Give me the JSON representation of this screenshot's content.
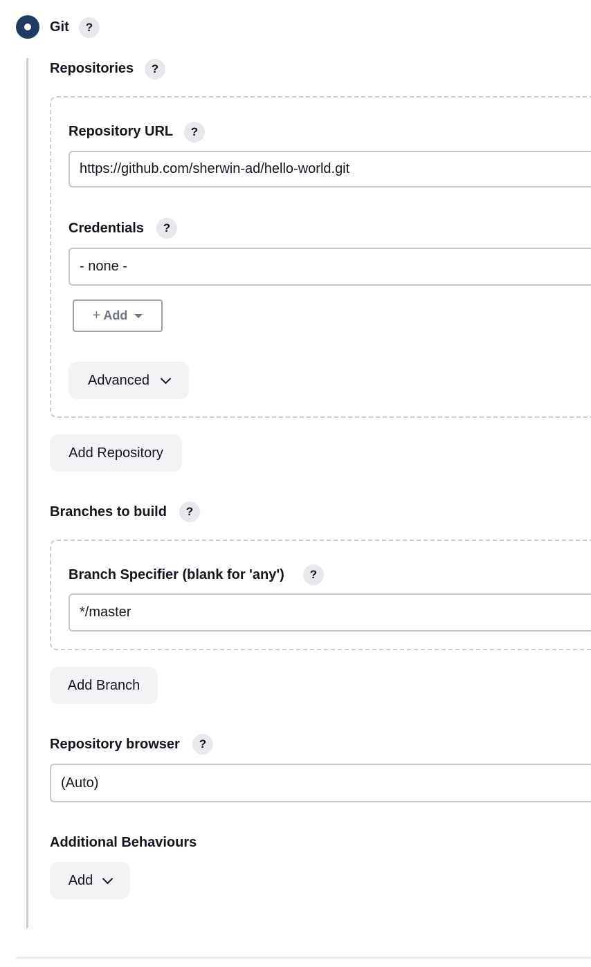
{
  "scm": {
    "option_label": "Git",
    "help": "?"
  },
  "repositories": {
    "label": "Repositories",
    "url_label": "Repository URL",
    "url_value": "https://github.com/sherwin-ad/hello-world.git",
    "credentials_label": "Credentials",
    "credentials_value": "- none -",
    "add_credentials": {
      "plus": "+",
      "label": "Add"
    },
    "advanced_label": "Advanced",
    "add_repository_label": "Add Repository"
  },
  "branches": {
    "label": "Branches to build",
    "specifier_label": "Branch Specifier (blank for 'any')",
    "specifier_value": "*/master",
    "add_branch_label": "Add Branch"
  },
  "browser": {
    "label": "Repository browser",
    "value": "(Auto)"
  },
  "behaviours": {
    "label": "Additional Behaviours",
    "add_label": "Add"
  },
  "colors": {
    "radio": "#1e3c64",
    "help_bg": "#e8e8ec",
    "button_bg": "#f3f3f6",
    "border": "#c4c7cd"
  }
}
